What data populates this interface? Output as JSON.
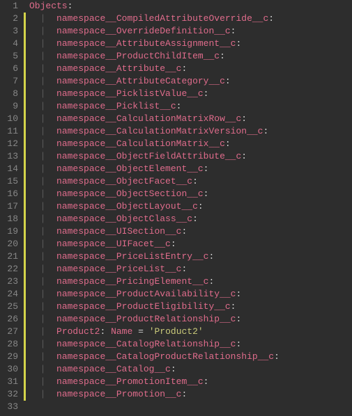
{
  "editor": {
    "rootKey": "Objects",
    "lines": [
      {
        "n": 1,
        "type": "root",
        "key": "Objects"
      },
      {
        "n": 2,
        "type": "item",
        "key": "namespace__CompiledAttributeOverride__c"
      },
      {
        "n": 3,
        "type": "item",
        "key": "namespace__OverrideDefinition__c"
      },
      {
        "n": 4,
        "type": "item",
        "key": "namespace__AttributeAssignment__c"
      },
      {
        "n": 5,
        "type": "item",
        "key": "namespace__ProductChildItem__c"
      },
      {
        "n": 6,
        "type": "item",
        "key": "namespace__Attribute__c"
      },
      {
        "n": 7,
        "type": "item",
        "key": "namespace__AttributeCategory__c"
      },
      {
        "n": 8,
        "type": "item",
        "key": "namespace__PicklistValue__c"
      },
      {
        "n": 9,
        "type": "item",
        "key": "namespace__Picklist__c"
      },
      {
        "n": 10,
        "type": "item",
        "key": "namespace__CalculationMatrixRow__c"
      },
      {
        "n": 11,
        "type": "item",
        "key": "namespace__CalculationMatrixVersion__c"
      },
      {
        "n": 12,
        "type": "item",
        "key": "namespace__CalculationMatrix__c"
      },
      {
        "n": 13,
        "type": "item",
        "key": "namespace__ObjectFieldAttribute__c"
      },
      {
        "n": 14,
        "type": "item",
        "key": "namespace__ObjectElement__c"
      },
      {
        "n": 15,
        "type": "item",
        "key": "namespace__ObjectFacet__c"
      },
      {
        "n": 16,
        "type": "item",
        "key": "namespace__ObjectSection__c"
      },
      {
        "n": 17,
        "type": "item",
        "key": "namespace__ObjectLayout__c"
      },
      {
        "n": 18,
        "type": "item",
        "key": "namespace__ObjectClass__c"
      },
      {
        "n": 19,
        "type": "item",
        "key": "namespace__UISection__c"
      },
      {
        "n": 20,
        "type": "item",
        "key": "namespace__UIFacet__c"
      },
      {
        "n": 21,
        "type": "item",
        "key": "namespace__PriceListEntry__c"
      },
      {
        "n": 22,
        "type": "item",
        "key": "namespace__PriceList__c"
      },
      {
        "n": 23,
        "type": "item",
        "key": "namespace__PricingElement__c"
      },
      {
        "n": 24,
        "type": "item",
        "key": "namespace__ProductAvailability__c"
      },
      {
        "n": 25,
        "type": "item",
        "key": "namespace__ProductEligibility__c"
      },
      {
        "n": 26,
        "type": "item",
        "key": "namespace__ProductRelationship__c"
      },
      {
        "n": 27,
        "type": "kv",
        "key": "Product2",
        "attr": "Name",
        "val": "'Product2'"
      },
      {
        "n": 28,
        "type": "item",
        "key": "namespace__CatalogRelationship__c"
      },
      {
        "n": 29,
        "type": "item",
        "key": "namespace__CatalogProductRelationship__c"
      },
      {
        "n": 30,
        "type": "item",
        "key": "namespace__Catalog__c"
      },
      {
        "n": 31,
        "type": "item",
        "key": "namespace__PromotionItem__c"
      },
      {
        "n": 32,
        "type": "item",
        "key": "namespace__Promotion__c"
      },
      {
        "n": 33,
        "type": "blank"
      }
    ],
    "symbols": {
      "colon": ":",
      "pipe": "|",
      "eq": " = "
    }
  }
}
